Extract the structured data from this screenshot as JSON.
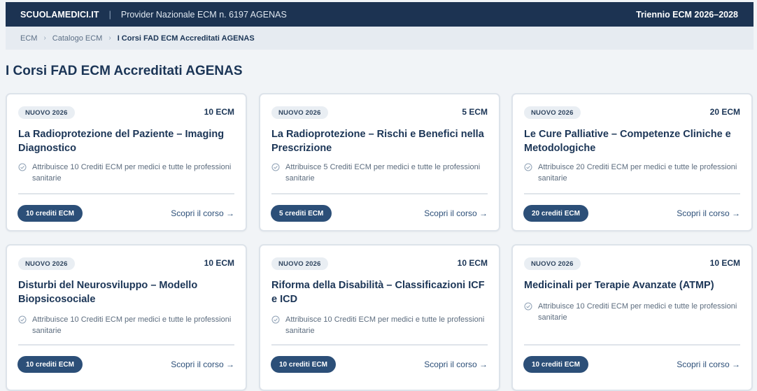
{
  "header": {
    "brand": "SCUOLAMEDICI.IT",
    "separator": "|",
    "provider": "Provider Nazionale ECM n. 6197 AGENAS",
    "period": "Triennio ECM 2026–2028"
  },
  "breadcrumb": {
    "items": [
      "ECM",
      "Catalogo ECM"
    ],
    "current": "I Corsi FAD ECM Accreditati AGENAS",
    "chevron": "›"
  },
  "page_title": "I Corsi FAD ECM Accreditati AGENAS",
  "courses": [
    {
      "badge": "NUOVO 2026",
      "ecm": "10 ECM",
      "title": "La Radioprotezione del Paziente – Imaging Diagnostico",
      "description": "Attribuisce 10 Crediti ECM per medici e tutte le professioni sanitarie",
      "credits_pill": "10 crediti ECM",
      "link": "Scopri il corso →"
    },
    {
      "badge": "NUOVO 2026",
      "ecm": "5 ECM",
      "title": "La Radioprotezione – Rischi e Benefici nella Prescrizione",
      "description": "Attribuisce 5 Crediti ECM per medici e tutte le professioni sanitarie",
      "credits_pill": "5 crediti ECM",
      "link": "Scopri il corso →"
    },
    {
      "badge": "NUOVO 2026",
      "ecm": "20 ECM",
      "title": "Le Cure Palliative – Competenze Cliniche e Metodologiche",
      "description": "Attribuisce 20 Crediti ECM per medici e tutte le professioni sanitarie",
      "credits_pill": "20 crediti ECM",
      "link": "Scopri il corso →"
    },
    {
      "badge": "NUOVO 2026",
      "ecm": "10 ECM",
      "title": "Disturbi del Neurosviluppo – Modello Biopsicosociale",
      "description": "Attribuisce 10 Crediti ECM per medici e tutte le professioni sanitarie",
      "credits_pill": "10 crediti ECM",
      "link": "Scopri il corso →"
    },
    {
      "badge": "NUOVO 2026",
      "ecm": "10 ECM",
      "title": "Riforma della Disabilità – Classificazioni ICF e ICD",
      "description": "Attribuisce 10 Crediti ECM per medici e tutte le professioni sanitarie",
      "credits_pill": "10 crediti ECM",
      "link": "Scopri il corso →"
    },
    {
      "badge": "NUOVO 2026",
      "ecm": "10 ECM",
      "title": "Medicinali per Terapie Avanzate (ATMP)",
      "description": "Attribuisce 10 Crediti ECM per medici e tutte le professioni sanitarie",
      "credits_pill": "10 crediti ECM",
      "link": "Scopri il corso →"
    }
  ],
  "icons": {
    "check": "check-circle-icon"
  },
  "colors": {
    "header_bg": "#1c3352",
    "accent": "#2c4f78",
    "page_bg": "#f1f4f7"
  }
}
